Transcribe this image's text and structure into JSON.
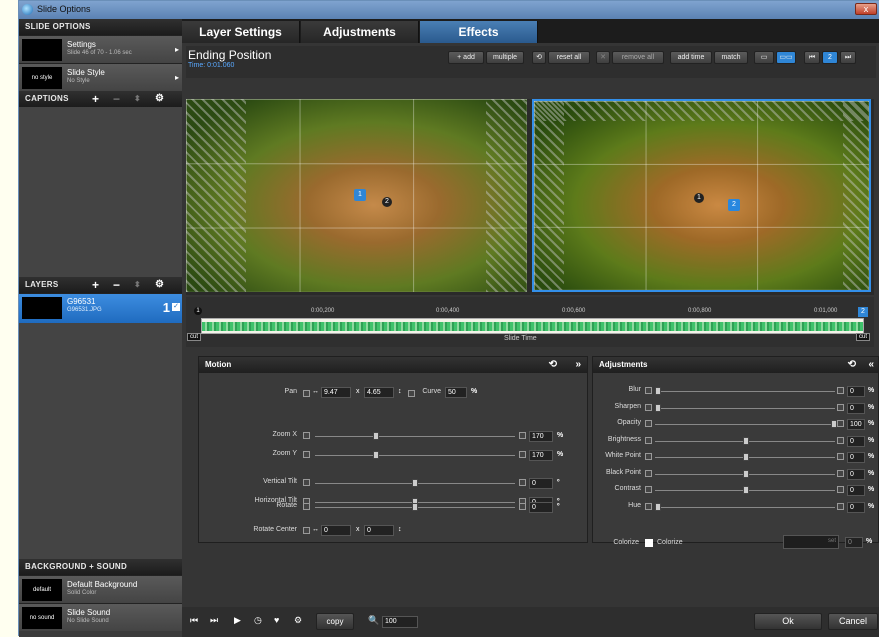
{
  "window": {
    "title": "Slide Options",
    "close_label": "x"
  },
  "left": {
    "slide_options_header": "SLIDE OPTIONS",
    "settings": {
      "title": "Settings",
      "sub": "Slide 46 of 70 - 1.06 sec"
    },
    "slide_style": {
      "thumb": "no style",
      "title": "Slide Style",
      "sub": "No Style"
    },
    "captions_header": "CAPTIONS",
    "layers_header": "LAYERS",
    "layer": {
      "name": "G96531",
      "file": "G96531.JPG",
      "number": "1"
    },
    "bg_sound_header": "BACKGROUND + SOUND",
    "background": {
      "thumb": "default",
      "title": "Default Background",
      "sub": "Solid Color"
    },
    "sound": {
      "thumb": "no sound",
      "title": "Slide Sound",
      "sub": "No Slide Sound"
    }
  },
  "tabs": [
    "Layer Settings",
    "Adjustments",
    "Effects"
  ],
  "active_tab": "Effects",
  "ending": {
    "title": "Ending Position",
    "time": "Time: 0:01.060"
  },
  "toolbar": {
    "add": "+ add",
    "multiple": "multiple",
    "reset_all": "reset all",
    "remove_all": "remove all",
    "add_time": "add time",
    "match": "match",
    "nav_number": "2"
  },
  "timeline": {
    "ticks": [
      "0:00,200",
      "0:00,400",
      "0:00,600",
      "0:00,800",
      "0:01,000"
    ],
    "start_marker": "1",
    "end_marker": "2",
    "cut_left": "cut",
    "cut_right": "cut",
    "slide_time": "Slide Time"
  },
  "markers": {
    "left_1": "1",
    "left_2": "2",
    "right_1": "1",
    "right_2": "2"
  },
  "motion": {
    "header": "Motion",
    "pan_label": "Pan",
    "pan_x": "9.47",
    "pan_x_sep": "x",
    "pan_y": "4.65",
    "curve_label": "Curve",
    "curve_value": "50",
    "curve_unit": "%",
    "zoom_x_label": "Zoom X",
    "zoom_x_value": "170",
    "zoom_y_label": "Zoom Y",
    "zoom_y_value": "170",
    "zoom_unit": "%",
    "vtilt_label": "Vertical Tilt",
    "vtilt_value": "0",
    "htilt_label": "Horizontal Tilt",
    "htilt_value": "0",
    "rotate_label": "Rotate",
    "rotate_value": "0",
    "deg_unit": "º",
    "rotcenter_label": "Rotate Center",
    "rotcenter_x": "0",
    "rotcenter_sep": "x",
    "rotcenter_y": "0"
  },
  "adjustments": {
    "header": "Adjustments",
    "rows": [
      {
        "label": "Blur",
        "value": "0",
        "knob": 0.0
      },
      {
        "label": "Sharpen",
        "value": "0",
        "knob": 0.0
      },
      {
        "label": "Opacity",
        "value": "100",
        "knob": 1.0
      },
      {
        "label": "Brightness",
        "value": "0",
        "knob": 0.5
      },
      {
        "label": "White Point",
        "value": "0",
        "knob": 0.5
      },
      {
        "label": "Black Point",
        "value": "0",
        "knob": 0.5
      },
      {
        "label": "Contrast",
        "value": "0",
        "knob": 0.5
      },
      {
        "label": "Hue",
        "value": "0",
        "knob": 0.0
      }
    ],
    "unit": "%",
    "colorize_label": "Colorize",
    "colorize_check_label": "Colorize",
    "colorize_set": "set",
    "colorize_value": "0"
  },
  "motion_knobs": {
    "zoom_x": 0.3,
    "zoom_y": 0.3,
    "vtilt": 0.5,
    "htilt": 0.5,
    "rotate": 0.5
  },
  "bottom": {
    "copy": "copy",
    "zoom": "100",
    "ok": "Ok",
    "cancel": "Cancel"
  }
}
